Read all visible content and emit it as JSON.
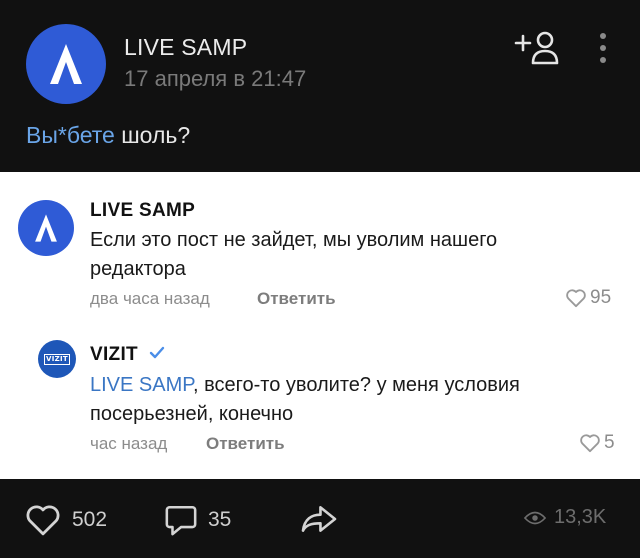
{
  "post": {
    "author": "LIVE SAMP",
    "date": "17 апреля в 21:47",
    "text_highlight": "Вы*бете",
    "text_rest": " шоль?"
  },
  "comments": [
    {
      "author": "LIVE SAMP",
      "text": "Если это пост не зайдет, мы уволим нашего редактора",
      "time": "два часа назад",
      "reply_label": "Ответить",
      "likes": "95"
    },
    {
      "author": "VIZIT",
      "avatar_text": "VIZIT",
      "verified": true,
      "mention": "LIVE SAMP",
      "text": ", всего-то уволите? у меня условия посерьезней, конечно",
      "time": "час назад",
      "reply_label": "Ответить",
      "likes": "5"
    }
  ],
  "footer": {
    "likes": "502",
    "comments": "35",
    "views": "13,3K"
  },
  "colors": {
    "brand_blue": "#2f5bd6",
    "link_blue": "#3a76c4",
    "dark_bg": "#111111"
  },
  "icons": [
    "add-friend-icon",
    "more-icon",
    "heart-icon",
    "comment-icon",
    "share-icon",
    "eye-icon",
    "verified-icon"
  ]
}
